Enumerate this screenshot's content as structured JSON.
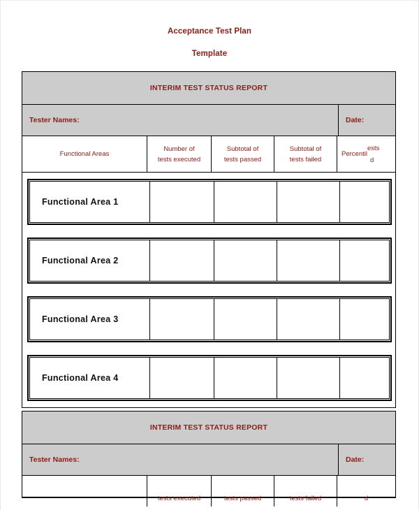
{
  "document": {
    "title_line_1": "Acceptance Test Plan",
    "title_line_2": "Template"
  },
  "colors": {
    "heading_red": "#8f1b14",
    "banner_gray": "#cccccc",
    "body_black": "#111111",
    "border": "#000000"
  },
  "report": {
    "banner_title": "INTERIM TEST STATUS REPORT",
    "tester_names_label": "Tester Names:",
    "date_label": "Date:",
    "columns": {
      "functional_areas": "Functional Areas",
      "number_executed_l1": "Number of",
      "number_executed_l2": "tests executed",
      "subtotal_passed_l1": "Subtotal of",
      "subtotal_passed_l2": "tests passed",
      "subtotal_failed_l1": "Subtotal of",
      "subtotal_failed_l2": "tests failed",
      "percentile_clipped_main": "Percentil",
      "percentile_clipped_over": "ests",
      "percentile_clipped_under": "d"
    },
    "rows": [
      {
        "name": "Functional Area 1",
        "executed": "",
        "passed": "",
        "failed": "",
        "percentile": ""
      },
      {
        "name": "Functional Area 2",
        "executed": "",
        "passed": "",
        "failed": "",
        "percentile": ""
      },
      {
        "name": "Functional Area 3",
        "executed": "",
        "passed": "",
        "failed": "",
        "percentile": ""
      },
      {
        "name": "Functional Area 4",
        "executed": "",
        "passed": "",
        "failed": "",
        "percentile": ""
      }
    ]
  },
  "report_bottom": {
    "banner_title": "INTERIM TEST STATUS REPORT",
    "tester_names_label": "Tester Names:",
    "date_label": "Date:",
    "clipped_headers": {
      "functional_areas": "",
      "executed": "tests executed",
      "passed": "tests passed",
      "failed": "tests failed",
      "percentile": "d"
    }
  }
}
